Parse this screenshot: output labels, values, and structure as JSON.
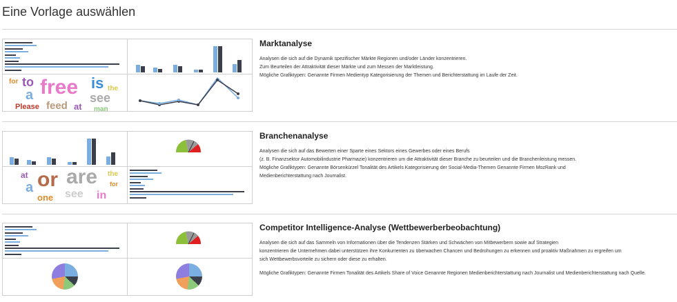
{
  "page": {
    "title": "Eine Vorlage auswählen"
  },
  "colors": {
    "dark": "#3a3f4b",
    "blue": "#7aaee0",
    "rule": "#d4d4d4"
  },
  "templates": [
    {
      "title": "Marktanalyse",
      "lines": [
        "Analysen die sich auf die Dynamik spezifischer Märkte Regionen und/oder Länder konzentrieren.",
        "Zum Beurteilen der Attraktivität dieser Märkte und zum Messen der Marktleistung.",
        "Mögliche Grafiktypen: Genannte Firmen Medientyp Kategorisierung der Themen und Berichterstattung im Laufe der Zeit."
      ],
      "wordcloud": [
        "for",
        "to",
        "free",
        "is",
        "the",
        "a",
        "see",
        "Please",
        "feed",
        "at",
        "man"
      ]
    },
    {
      "title": "Branchenanalyse",
      "lines": [
        "Analysen die sich auf das Bewerten einer Sparte eines Sektors eines Gewerbes oder eines Berufs",
        "(z. B. Finanzsektor Automobilindustrie Pharmazie) konzentrieren um die Attraktivität dieser Branche zu beurteilen und die Branchenleistung messen.",
        "Mögliche Grafiktypen: Genannte Börsenkürzel Tonalität des Artikels Kategorisierung der Social-Media-Themen Genannte Firmen MozRank und",
        "Medienberichterstattung nach Journalist."
      ],
      "wordcloud": [
        "at",
        "or",
        "are",
        "the",
        "a",
        "for",
        "one",
        "see",
        "in"
      ]
    },
    {
      "title": "Competitor Intelligence-Analyse (Wettbewerberbeobachtung)",
      "lines": [
        "Analysen die sich auf das Sammeln von Informationen über die Tendenzen Stärken und Schwächen von Mitbewerbern sowie auf Strategien",
        "konzentrieren die Unternehmen dabei unterstützen ihre Konkurrenten zu überwachen Chancen und Bedrohungen zu erkennen und proaktiv Maßnahmen zu ergreifen um",
        "sich Wettbewerbsvorteile zu sichern oder diese zu erhalten."
      ],
      "extra_line": "Mögliche Grafiktypen: Genannte Firmen Tonalität des Artikels Share of Voice Genannte Regionen Medienberichterstattung nach Journalist und Medienberichterstattung nach Quelle."
    }
  ]
}
